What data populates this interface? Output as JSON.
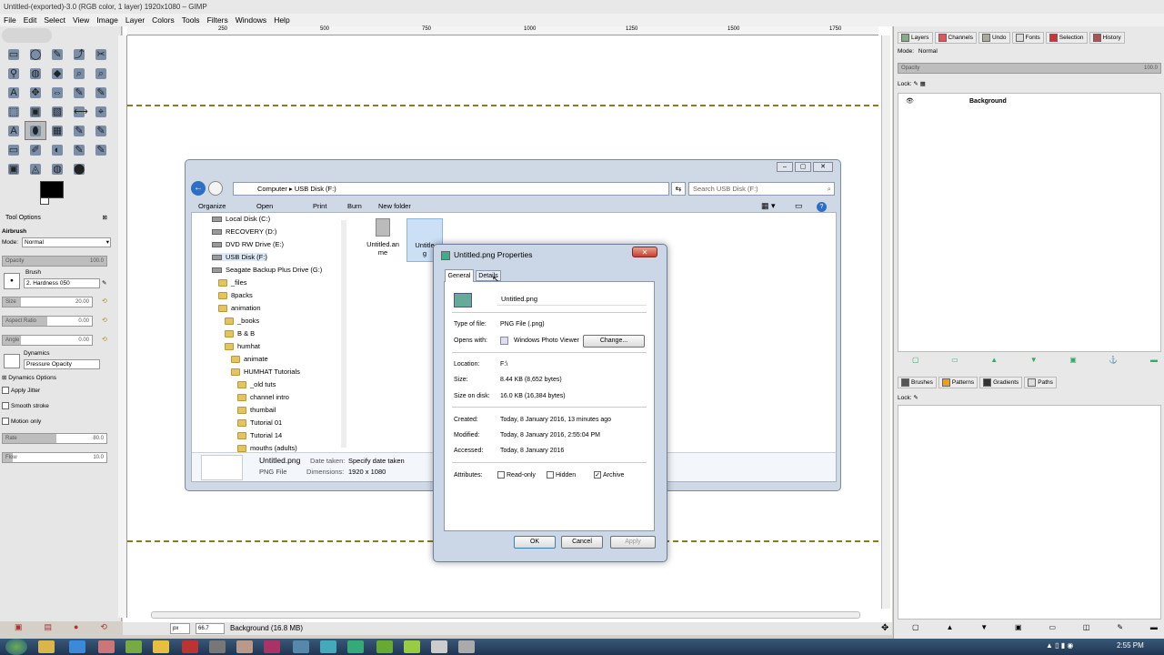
{
  "gimp": {
    "window_title": "Untitled-(exported)-3.0 (RGB color, 1 layer) 1920x1080 – GIMP",
    "menu": [
      "File",
      "Edit",
      "Select",
      "View",
      "Image",
      "Layer",
      "Colors",
      "Tools",
      "Filters",
      "Windows",
      "Help"
    ],
    "ruler_ticks": [
      "250",
      "500",
      "750",
      "1000",
      "1250",
      "1500",
      "1750"
    ],
    "tool_options": {
      "tab": "Tool Options",
      "tool_name": "Airbrush",
      "mode_label": "Mode:",
      "mode_value": "Normal",
      "opacity_label": "Opacity",
      "opacity_value": "100.0",
      "brush_label": "Brush",
      "brush_value": "2. Hardness 050",
      "size_label": "Size",
      "size_value": "20.00",
      "aspect_label": "Aspect Ratio",
      "aspect_value": "0.00",
      "angle_label": "Angle",
      "angle_value": "0.00",
      "dynamics_label": "Dynamics",
      "dynamics_value": "Pressure Opacity",
      "dynamics_options": "Dynamics Options",
      "apply_jitter": "Apply Jitter",
      "smooth_stroke": "Smooth stroke",
      "motion_only": "Motion only",
      "rate_label": "Rate",
      "rate_value": "80.0",
      "flow_label": "Flow",
      "flow_value": "10.0"
    },
    "status": {
      "unit": "px",
      "zoom": "66.7",
      "message": "Background (16.8 MB)"
    },
    "layers_panel": {
      "tabs": [
        "Layers",
        "Channels",
        "Undo",
        "Fonts",
        "Selection",
        "History"
      ],
      "mode_label": "Mode:",
      "mode_value": "Normal",
      "opacity_label": "Opacity",
      "opacity_value": "100.0",
      "lock_label": "Lock:",
      "layer_name": "Background"
    },
    "brushes_panel": {
      "tabs": [
        "Brushes",
        "Patterns",
        "Gradients",
        "Paths"
      ],
      "lock_label": "Lock:"
    }
  },
  "explorer": {
    "breadcrumb": [
      "Computer",
      "USB Disk (F:)"
    ],
    "search_placeholder": "Search USB Disk (F:)",
    "toolbar": [
      "Organize",
      "Open",
      "Print",
      "Burn",
      "New folder"
    ],
    "tree": [
      {
        "label": "Local Disk (C:)",
        "kind": "drive",
        "indent": 0
      },
      {
        "label": "RECOVERY (D:)",
        "kind": "drive",
        "indent": 0
      },
      {
        "label": "DVD RW Drive (E:)",
        "kind": "drive",
        "indent": 0
      },
      {
        "label": "USB Disk (F:)",
        "kind": "drive",
        "indent": 0
      },
      {
        "label": "Seagate Backup Plus Drive (G:)",
        "kind": "drive",
        "indent": 0
      },
      {
        "label": "_files",
        "kind": "folder",
        "indent": 1
      },
      {
        "label": "8packs",
        "kind": "folder",
        "indent": 1
      },
      {
        "label": "animation",
        "kind": "folder",
        "indent": 1
      },
      {
        "label": "_books",
        "kind": "folder",
        "indent": 2
      },
      {
        "label": "B & B",
        "kind": "folder",
        "indent": 2
      },
      {
        "label": "humhat",
        "kind": "folder",
        "indent": 2
      },
      {
        "label": "animate",
        "kind": "folder",
        "indent": 3
      },
      {
        "label": "HUMHAT Tutorials",
        "kind": "folder",
        "indent": 3
      },
      {
        "label": "_old tuts",
        "kind": "folder",
        "indent": 4
      },
      {
        "label": "channel intro",
        "kind": "folder",
        "indent": 4
      },
      {
        "label": "thumbail",
        "kind": "folder",
        "indent": 4
      },
      {
        "label": "Tutorial 01",
        "kind": "folder",
        "indent": 4
      },
      {
        "label": "Tutorial 14",
        "kind": "folder",
        "indent": 4
      },
      {
        "label": "mouths  (adults)",
        "kind": "folder",
        "indent": 4
      }
    ],
    "files": [
      {
        "label1": "Untitled.an",
        "label2": "me"
      },
      {
        "label1": "Untitle",
        "label2": "g"
      }
    ],
    "details": {
      "name": "Untitled.png",
      "type": "PNG File",
      "date_label": "Date taken:",
      "date_value": "Specify date taken",
      "dims_label": "Dimensions:",
      "dims_value": "1920 x 1080"
    }
  },
  "properties": {
    "title": "Untitled.png Properties",
    "tabs": [
      "General",
      "Details"
    ],
    "filename": "Untitled.png",
    "rows": {
      "type_label": "Type of file:",
      "type_value": "PNG File (.png)",
      "opens_label": "Opens with:",
      "opens_value": "Windows Photo Viewer",
      "change_button": "Change...",
      "location_label": "Location:",
      "location_value": "F:\\",
      "size_label": "Size:",
      "size_value": "8.44 KB (8,652 bytes)",
      "disk_label": "Size on disk:",
      "disk_value": "16.0 KB (16,384 bytes)",
      "created_label": "Created:",
      "created_value": "Today, 8 January 2016, 13 minutes ago",
      "modified_label": "Modified:",
      "modified_value": "Today, 8 January 2016, 2:55:04 PM",
      "accessed_label": "Accessed:",
      "accessed_value": "Today, 8 January 2016",
      "attributes_label": "Attributes:",
      "readonly": "Read-only",
      "hidden": "Hidden",
      "archive": "Archive"
    },
    "buttons": {
      "ok": "OK",
      "cancel": "Cancel",
      "apply": "Apply"
    }
  },
  "taskbar": {
    "clock": "2:55 PM"
  },
  "colors": {
    "gimp_bg": "#e6e6e6",
    "dialog_frame": "#cbd7e6",
    "taskbar": "#1e3552",
    "guide": "#8a7a20"
  }
}
